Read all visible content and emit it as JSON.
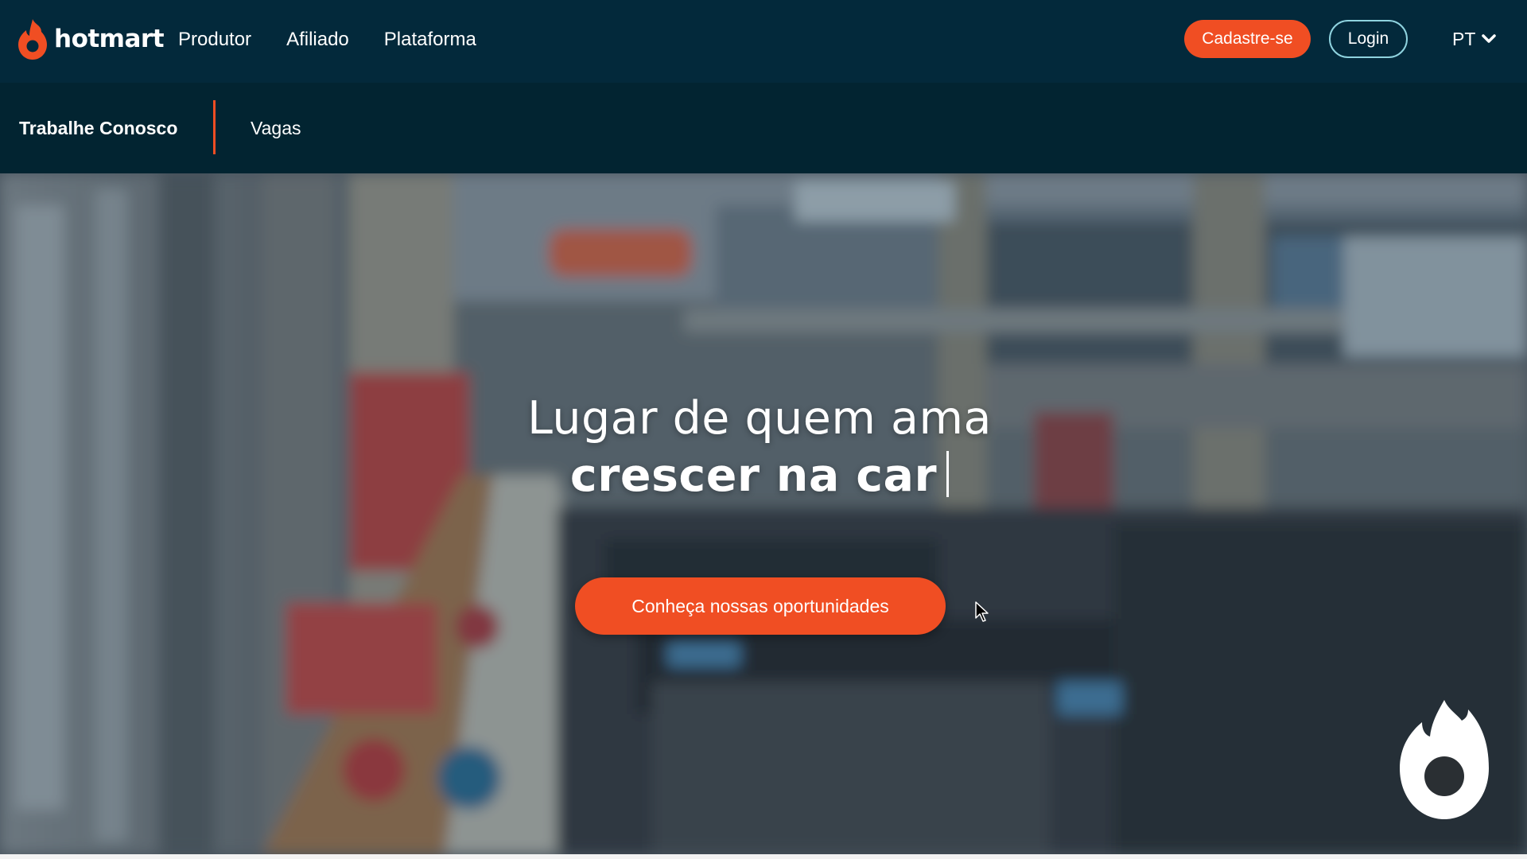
{
  "brand": {
    "name": "hotmart",
    "accent_color": "#f04e23",
    "nav_bg_color": "#03293b",
    "logo_icon": "hotmart-flame-icon"
  },
  "main_nav": {
    "items": [
      {
        "label": "Produtor"
      },
      {
        "label": "Afiliado"
      },
      {
        "label": "Plataforma"
      }
    ]
  },
  "actions": {
    "signup_label": "Cadastre-se",
    "login_label": "Login",
    "language": "PT",
    "language_icon": "chevron-down-icon"
  },
  "sub_nav": {
    "title": "Trabalhe Conosco",
    "items": [
      {
        "label": "Vagas"
      }
    ]
  },
  "hero": {
    "headline_line1": "Lugar de quem ama",
    "headline_line2": "crescer na car",
    "cta_label": "Conheça nossas oportunidades",
    "background": "blurred office photo",
    "badge_icon": "hotmart-flame-badge-icon"
  }
}
